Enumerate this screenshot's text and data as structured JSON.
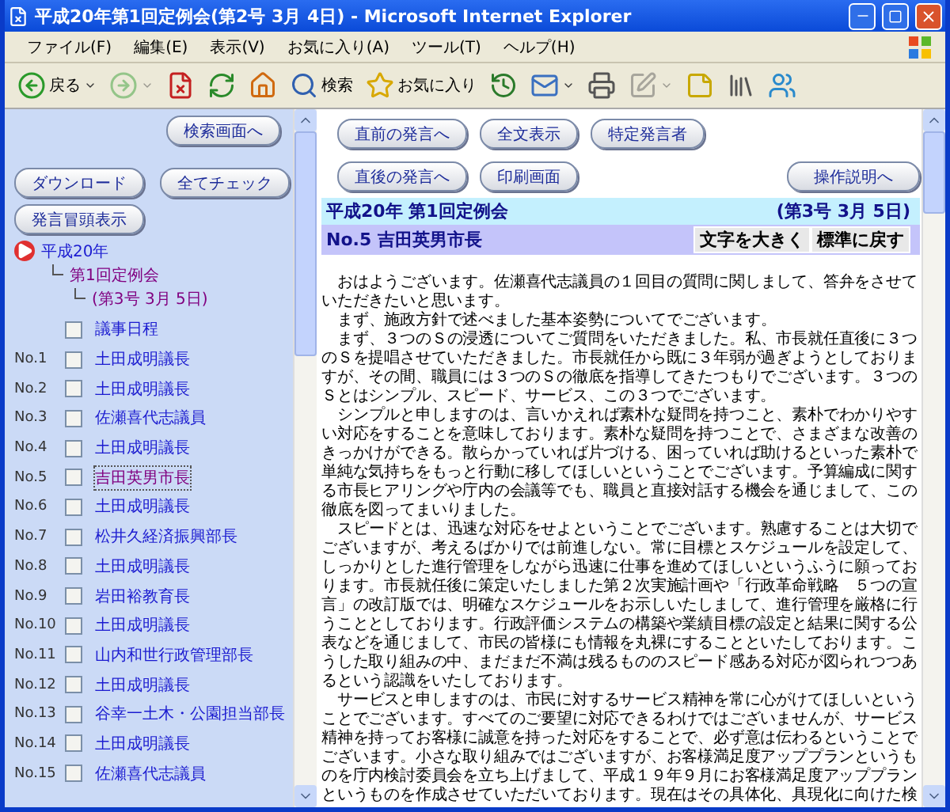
{
  "window": {
    "title": "平成20年第1回定例会(第2号 3月 4日) - Microsoft Internet Explorer"
  },
  "menu": [
    "ファイル(F)",
    "編集(E)",
    "表示(V)",
    "お気に入り(A)",
    "ツール(T)",
    "ヘルプ(H)"
  ],
  "toolbar": [
    {
      "kind": "back",
      "label": "戻る",
      "dropdown": true,
      "disabled": false
    },
    {
      "kind": "forward",
      "dropdown": true,
      "disabled": true
    },
    {
      "kind": "stop",
      "dropdown": false,
      "disabled": false
    },
    {
      "kind": "refresh",
      "dropdown": false,
      "disabled": false
    },
    {
      "kind": "home",
      "dropdown": false,
      "disabled": false
    },
    {
      "kind": "search",
      "label": "検索",
      "dropdown": false,
      "disabled": false
    },
    {
      "kind": "favorites",
      "label": "お気に入り",
      "dropdown": false,
      "disabled": false
    },
    {
      "kind": "history",
      "dropdown": false,
      "disabled": false
    },
    {
      "kind": "mail",
      "dropdown": true,
      "disabled": false
    },
    {
      "kind": "print",
      "dropdown": false,
      "disabled": false
    },
    {
      "kind": "edit",
      "dropdown": true,
      "disabled": true
    },
    {
      "kind": "note",
      "dropdown": false,
      "disabled": false
    },
    {
      "kind": "research",
      "dropdown": false,
      "disabled": false
    },
    {
      "kind": "messenger",
      "dropdown": false,
      "disabled": false
    }
  ],
  "sidebar": {
    "search_button": "検索画面へ",
    "buttons": [
      "ダウンロード",
      "全てチェック",
      "発言冒頭表示"
    ],
    "tree": [
      {
        "label": "平成20年",
        "children": [
          {
            "label": "第1回定例会",
            "children": [
              {
                "label": "(第3号 3月 5日)"
              }
            ]
          }
        ]
      }
    ],
    "items": [
      {
        "label": "議事日程",
        "checked": false,
        "selected": false
      },
      {
        "number": "No.1",
        "label": "土田成明議長",
        "checked": false,
        "selected": false
      },
      {
        "number": "No.2",
        "label": "土田成明議長",
        "checked": false,
        "selected": false
      },
      {
        "number": "No.3",
        "label": "佐瀬喜代志議員",
        "checked": false,
        "selected": false
      },
      {
        "number": "No.4",
        "label": "土田成明議長",
        "checked": false,
        "selected": false
      },
      {
        "number": "No.5",
        "label": "吉田英男市長",
        "checked": false,
        "selected": true
      },
      {
        "number": "No.6",
        "label": "土田成明議長",
        "checked": false,
        "selected": false
      },
      {
        "number": "No.7",
        "label": "松井久経済振興部長",
        "checked": false,
        "selected": false
      },
      {
        "number": "No.8",
        "label": "土田成明議長",
        "checked": false,
        "selected": false
      },
      {
        "number": "No.9",
        "label": "岩田裕教育長",
        "checked": false,
        "selected": false
      },
      {
        "number": "No.10",
        "label": "土田成明議長",
        "checked": false,
        "selected": false
      },
      {
        "number": "No.11",
        "label": "山内和世行政管理部長",
        "checked": false,
        "selected": false
      },
      {
        "number": "No.12",
        "label": "土田成明議長",
        "checked": false,
        "selected": false
      },
      {
        "number": "No.13",
        "label": "谷幸一土木・公園担当部長",
        "checked": false,
        "selected": false
      },
      {
        "number": "No.14",
        "label": "土田成明議長",
        "checked": false,
        "selected": false
      },
      {
        "number": "No.15",
        "label": "佐瀬喜代志議員",
        "checked": false,
        "selected": false
      }
    ]
  },
  "main": {
    "nav_rows": [
      [
        "直前の発言へ",
        "全文表示",
        "特定発言者"
      ],
      [
        "直後の発言へ",
        "印刷画面"
      ]
    ],
    "help_button": "操作説明へ",
    "session": "平成20年 第1回定例会",
    "issue": "(第3号 3月 5日)",
    "speaker": "No.5 吉田英男市長",
    "font_buttons": [
      "文字を大きく",
      "標準に戻す"
    ],
    "paragraphs": [
      "おはようございます。佐瀬喜代志議員の１回目の質問に関しまして、答弁をさせていただきたいと思います。",
      "まず、施政方針で述べました基本姿勢についてでございます。",
      "まず、３つのＳの浸透についてご質問をいただきました。私、市長就任直後に３つのＳを提唱させていただきました。市長就任から既に３年弱が過ぎようとしておりますが、その間、職員には３つのＳの徹底を指導してきたつもりでございます。３つのＳとはシンプル、スピード、サービス、この３つでございます。",
      "シンプルと申しますのは、言いかえれば素朴な疑問を持つこと、素朴でわかりやすい対応をすることを意味しております。素朴な疑問を持つことで、さまざまな改善のきっかけができる。散らかっていれば片づける、困っていれば助けるといった素朴で単純な気持ちをもっと行動に移してほしいということでございます。予算編成に関する市長ヒアリングや庁内の会議等でも、職員と直接対話する機会を通じまして、この徹底を図ってまいりました。",
      "スピードとは、迅速な対応をせよということでございます。熟慮することは大切でございますが、考えるばかりでは前進しない。常に目標とスケジュールを設定して、しっかりとした進行管理をしながら迅速に仕事を進めてほしいというふうに願っております。市長就任後に策定いたしました第２次実施計画や「行政革命戦略　５つの宣言」の改訂版では、明確なスケジュールをお示しいたしまして、進行管理を厳格に行うこととしております。行政評価システムの構築や業績目標の設定と結果に関する公表などを通じまして、市民の皆様にも情報を丸裸にすることといたしております。こうした取り組みの中、まだまだ不満は残るもののスピード感ある対応が図られつつあるという認識をいたしております。",
      "サービスと申しますのは、市民に対するサービス精神を常に心がけてほしいということでございます。すべてのご要望に対応できるわけではございませんが、サービス精神を持ってお客様に誠意を持った対応をすることで、必ず意は伝わるということでございます。小さな取り組みではございますが、お客様満足度アッププランというものを庁内検討委員会を立ち上げまして、平成１９年９月にお客様満足度アッププランというものを作成させていただいております。現在はその具体化、具現化に向けた検"
    ]
  }
}
